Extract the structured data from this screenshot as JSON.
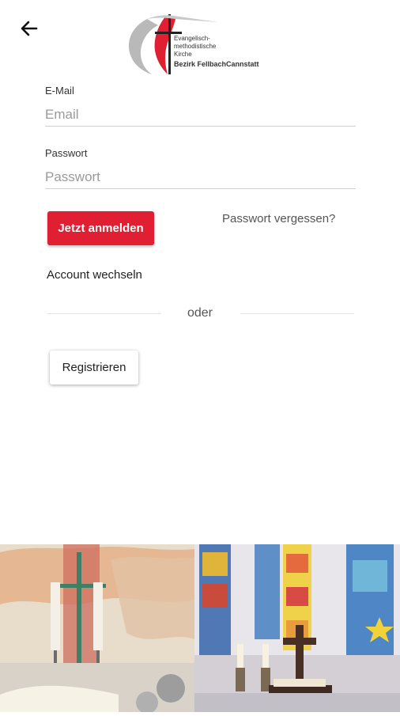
{
  "header": {
    "back_icon": "arrow-left-icon",
    "logo": {
      "line1": "Evangelisch-",
      "line2": "methodistische",
      "line3": "Kirche",
      "bezirk": "Bezirk FellbachCannstatt",
      "brand_color": "#e02032"
    }
  },
  "form": {
    "email_label": "E-Mail",
    "email_placeholder": "Email",
    "email_value": "",
    "password_label": "Passwort",
    "password_placeholder": "Passwort",
    "password_value": ""
  },
  "actions": {
    "login_label": "Jetzt anmelden",
    "forgot_label": "Passwort vergessen?",
    "switch_account_label": "Account wechseln",
    "divider_label": "oder",
    "register_label": "Registrieren"
  },
  "colors": {
    "accent": "#e02032",
    "background": "#ffffff"
  },
  "banner": {
    "left_image": "altar-with-cross-and-candles",
    "right_image": "church-interior-stained-glass"
  }
}
